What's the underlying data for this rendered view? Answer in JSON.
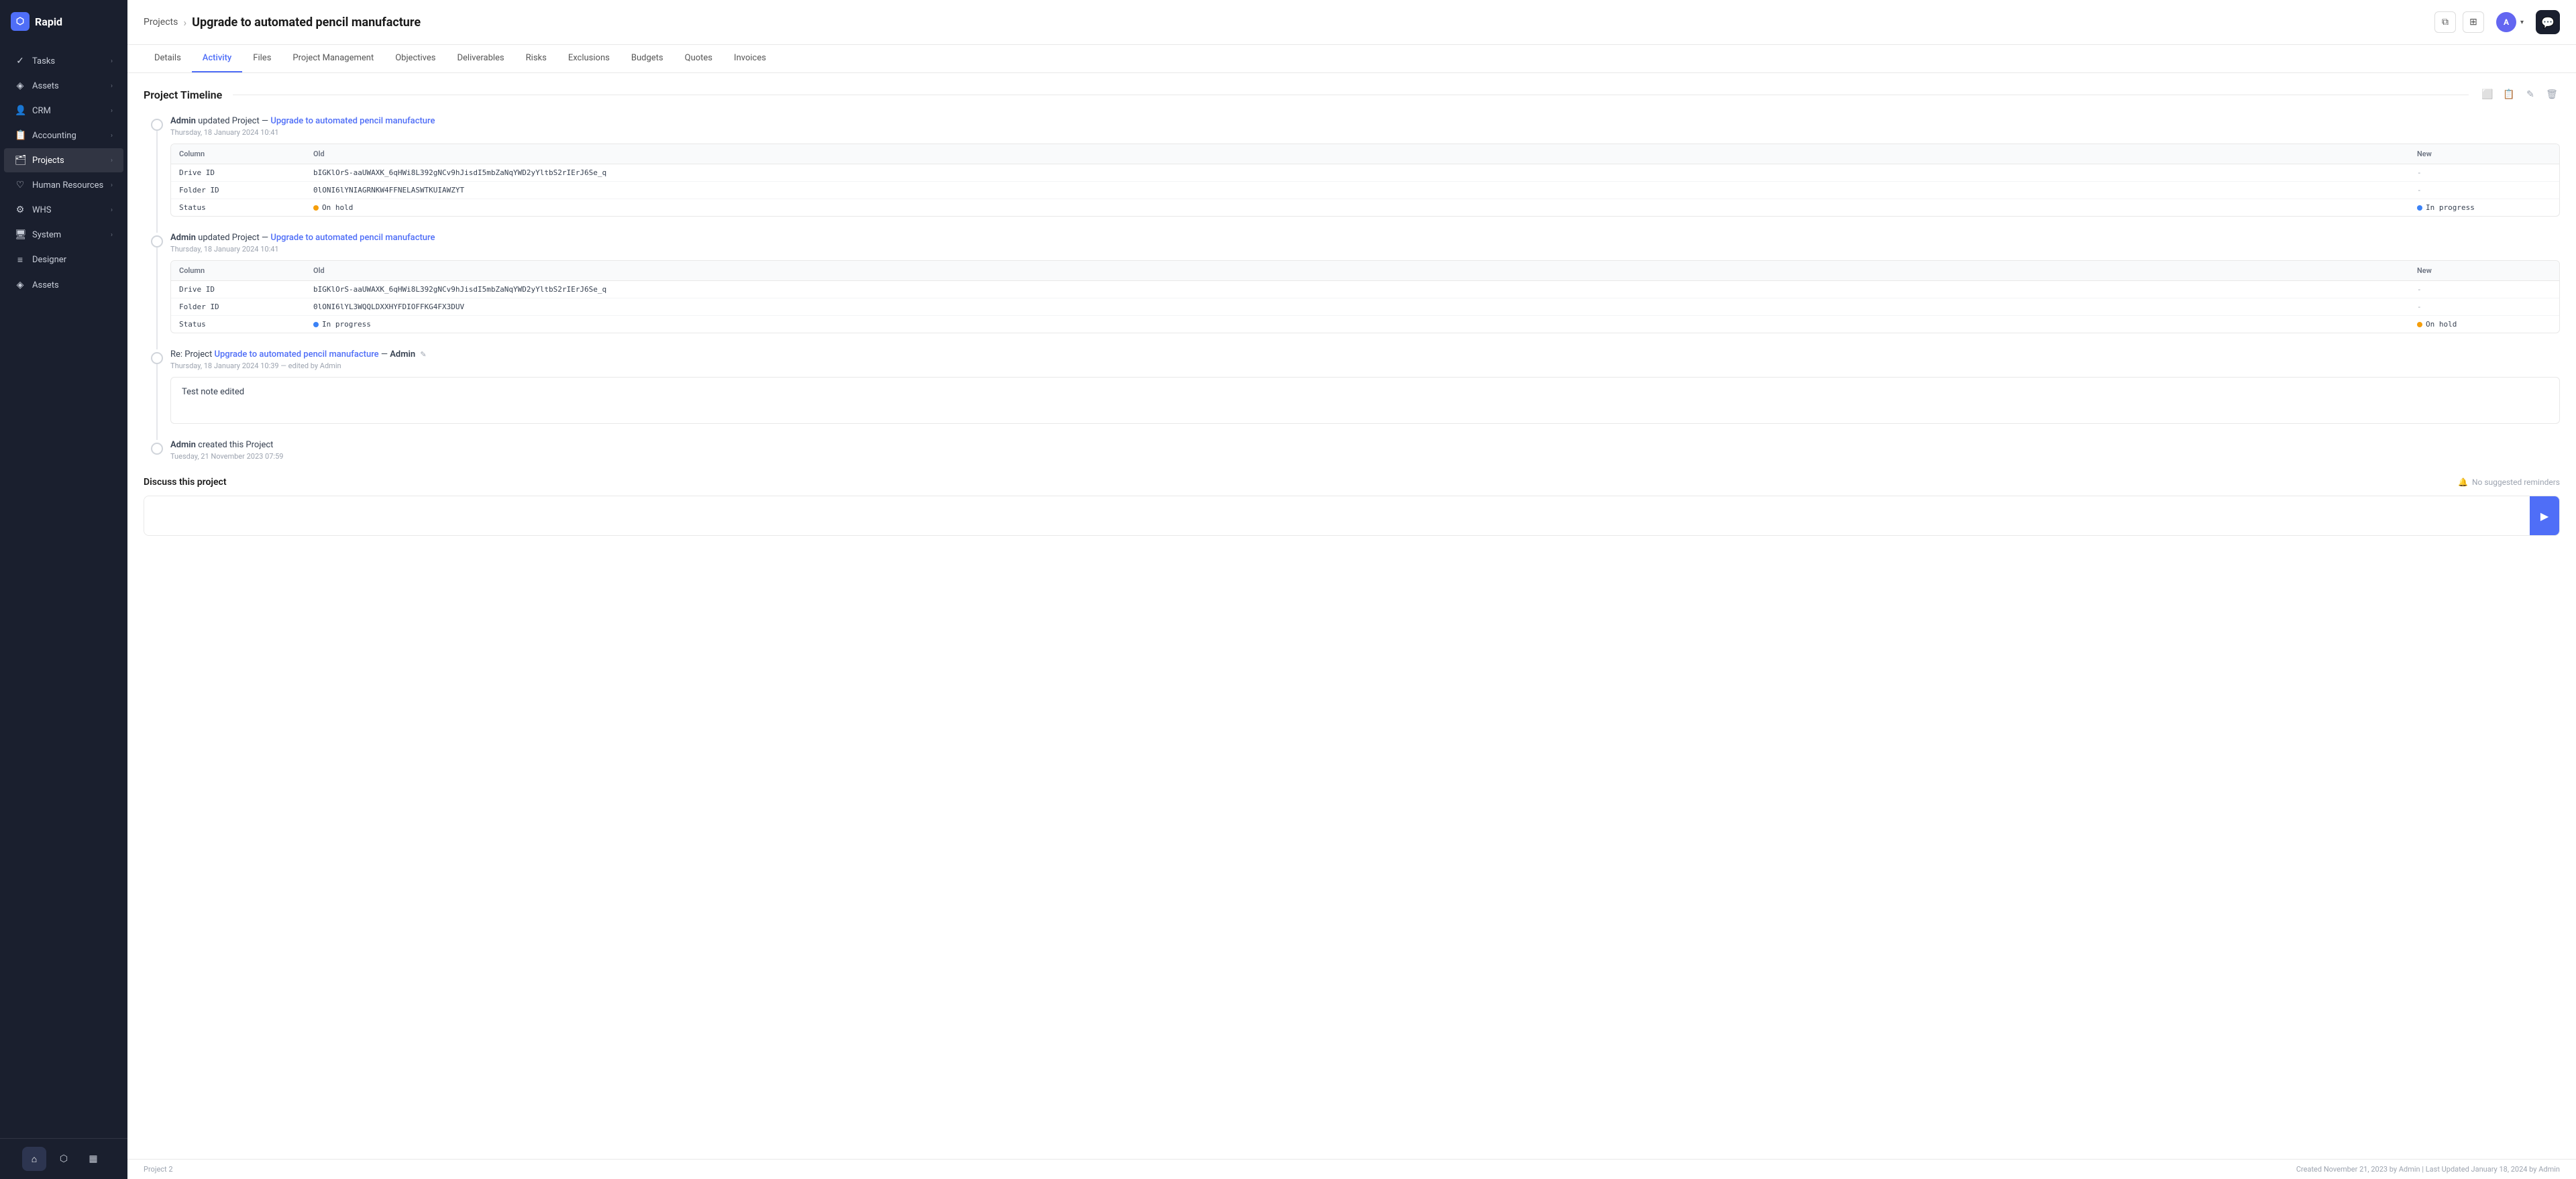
{
  "app": {
    "name": "Rapid",
    "logo_symbol": "R"
  },
  "sidebar": {
    "items": [
      {
        "id": "tasks",
        "label": "Tasks",
        "icon": "✓",
        "has_children": true
      },
      {
        "id": "assets",
        "label": "Assets",
        "icon": "◈",
        "has_children": true
      },
      {
        "id": "crm",
        "label": "CRM",
        "icon": "👤",
        "has_children": true
      },
      {
        "id": "accounting",
        "label": "Accounting",
        "icon": "📋",
        "has_children": true
      },
      {
        "id": "projects",
        "label": "Projects",
        "icon": "🗂",
        "has_children": true,
        "active": true
      },
      {
        "id": "human-resources",
        "label": "Human Resources",
        "icon": "♡",
        "has_children": true
      },
      {
        "id": "whs",
        "label": "WHS",
        "icon": "⚙",
        "has_children": true
      },
      {
        "id": "system",
        "label": "System",
        "icon": "🖥",
        "has_children": true
      },
      {
        "id": "designer",
        "label": "Designer",
        "icon": "≡",
        "has_children": false
      },
      {
        "id": "assets2",
        "label": "Assets",
        "icon": "◈",
        "has_children": false
      }
    ],
    "footer_buttons": [
      {
        "id": "home",
        "icon": "⌂",
        "active": true
      },
      {
        "id": "graph",
        "icon": "⬡",
        "active": false
      },
      {
        "id": "chart",
        "icon": "▦",
        "active": false
      }
    ]
  },
  "header": {
    "breadcrumb_parent": "Projects",
    "breadcrumb_separator": "›",
    "page_title": "Upgrade to automated pencil manufacture",
    "actions": {
      "copy_icon": "⧉",
      "grid_icon": "⊞",
      "avatar_initial": "A",
      "avatar_chevron": "▾",
      "chat_icon": "💬"
    }
  },
  "tabs": [
    {
      "id": "details",
      "label": "Details",
      "active": false
    },
    {
      "id": "activity",
      "label": "Activity",
      "active": true
    },
    {
      "id": "files",
      "label": "Files",
      "active": false
    },
    {
      "id": "project-management",
      "label": "Project Management",
      "active": false
    },
    {
      "id": "objectives",
      "label": "Objectives",
      "active": false
    },
    {
      "id": "deliverables",
      "label": "Deliverables",
      "active": false
    },
    {
      "id": "risks",
      "label": "Risks",
      "active": false
    },
    {
      "id": "exclusions",
      "label": "Exclusions",
      "active": false
    },
    {
      "id": "budgets",
      "label": "Budgets",
      "active": false
    },
    {
      "id": "quotes",
      "label": "Quotes",
      "active": false
    },
    {
      "id": "invoices",
      "label": "Invoices",
      "active": false
    }
  ],
  "timeline": {
    "title": "Project Timeline",
    "icons": [
      "⬜",
      "📋",
      "✎",
      "🗑"
    ],
    "items": [
      {
        "id": "item1",
        "type": "update",
        "actor": "Admin",
        "action": "updated Project",
        "dash": "—",
        "link_text": "Upgrade to automated pencil manufacture",
        "timestamp": "Thursday, 18 January 2024 10:41",
        "changes": {
          "headers": {
            "column": "Column",
            "old": "Old",
            "new": "New"
          },
          "rows": [
            {
              "column": "Drive ID",
              "old": "bIGKlOrS-aaUWAXK_6qHWi8L392gNCv9hJisdI5mbZaNqYWD2yYltbS2rIErJ6Se_q",
              "new": "-"
            },
            {
              "column": "Folder ID",
              "old": "0lONI6lYNIAGRNKW4FFNELASWTKUIAWZYT",
              "new": "-"
            },
            {
              "column": "Status",
              "old_status": "On hold",
              "old_status_type": "on-hold",
              "new_status": "In progress",
              "new_status_type": "in-progress"
            }
          ]
        }
      },
      {
        "id": "item2",
        "type": "update",
        "actor": "Admin",
        "action": "updated Project",
        "dash": "—",
        "link_text": "Upgrade to automated pencil manufacture",
        "timestamp": "Thursday, 18 January 2024 10:41",
        "changes": {
          "headers": {
            "column": "Column",
            "old": "Old",
            "new": "New"
          },
          "rows": [
            {
              "column": "Drive ID",
              "old": "bIGKlOrS-aaUWAXK_6qHWi8L392gNCv9hJisdI5mbZaNqYWD2yYltbS2rIErJ6Se_q",
              "new": "-"
            },
            {
              "column": "Folder ID",
              "old": "0lONI6lYL3WQQLDXXHYFDIOFFKG4FX3DUV",
              "new": "-"
            },
            {
              "column": "Status",
              "old_status": "In progress",
              "old_status_type": "in-progress",
              "new_status": "On hold",
              "new_status_type": "on-hold"
            }
          ]
        }
      },
      {
        "id": "item3",
        "type": "note",
        "prefix": "Re: Project",
        "link_text": "Upgrade to automated pencil manufacture",
        "dash": "—",
        "actor": "Admin",
        "edit_icon": "✎",
        "timestamp": "Thursday, 18 January 2024 10:39",
        "edited_by": "edited by Admin",
        "note_text": "Test note edited"
      },
      {
        "id": "item4",
        "type": "created",
        "actor": "Admin",
        "action": "created this Project",
        "timestamp": "Tuesday, 21 November 2023 07:59"
      }
    ]
  },
  "discuss": {
    "title": "Discuss this project",
    "no_reminders_icon": "🔔",
    "no_reminders_text": "No suggested reminders",
    "input_placeholder": "",
    "send_icon": "▶"
  },
  "footer": {
    "project_label": "Project",
    "project_number": "2",
    "meta_text": "Created November 21, 2023 by Admin | Last Updated January 18, 2024 by Admin"
  }
}
